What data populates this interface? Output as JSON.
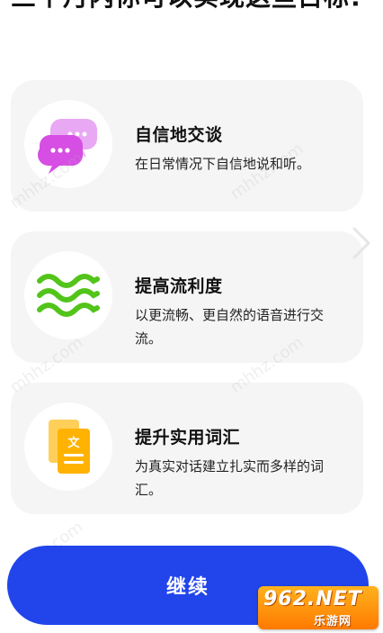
{
  "header": {
    "headline": "三个月内你可以实现这些目标!"
  },
  "goals": [
    {
      "icon": "chat-bubbles-icon",
      "title": "自信地交谈",
      "description": "在日常情况下自信地说和听。"
    },
    {
      "icon": "waves-icon",
      "title": "提高流利度",
      "description": "以更流畅、更自然的语音进行交流。"
    },
    {
      "icon": "document-text-icon",
      "title": "提升实用词汇",
      "description": "为真实对话建立扎实而多样的词汇。"
    }
  ],
  "footer": {
    "continue_label": "继续"
  },
  "watermark": {
    "text": "mhhz.com",
    "logo_top": "962.NET",
    "logo_bottom": "乐游网"
  },
  "colors": {
    "accent": "#2145ea",
    "card_bg": "#f5f5f5",
    "chat_pink": "#d64ee3",
    "chat_light": "#e9a8f4",
    "wave_green": "#52c41a",
    "doc_orange": "#ffb300"
  }
}
